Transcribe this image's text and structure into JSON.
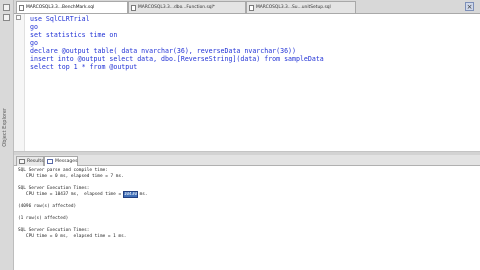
{
  "left_strip": {
    "label": "Object Explorer"
  },
  "tabs": [
    {
      "label": "MARCOSQL3.3...BenchMark.sql",
      "state": "active"
    },
    {
      "label": "MARCOSQL3.3...dbo...Function.sql*",
      "state": "inactive"
    },
    {
      "label": "MARCOSQL3.3...Su...unitSetup.sql",
      "state": "inactive"
    }
  ],
  "tab_close_glyph": "×",
  "editor": {
    "lines": [
      {
        "kw": "use",
        "rest": " SqlCLRTrial"
      },
      {
        "kw": "go",
        "rest": ""
      },
      {
        "kw": "set statistics time on",
        "rest": ""
      },
      {
        "kw": "go",
        "rest": ""
      },
      {
        "kw": "declare",
        "rest": " @output table( data nvarchar(36), reverseData nvarchar(36))"
      },
      {
        "kw": "insert into",
        "rest": " @output select data, dbo.[ReverseString](data) from sampleData"
      },
      {
        "kw": "select top",
        "rest": " 1 * from @output"
      }
    ]
  },
  "results_tabs": [
    {
      "label": "Results",
      "state": "inactive"
    },
    {
      "label": "Messages",
      "state": "active"
    }
  ],
  "messages": {
    "lines": [
      "SQL Server parse and compile time:",
      "   CPU time = 0 ms, elapsed time = 7 ms.",
      "",
      "SQL Server Execution Times:",
      "   CPU time = 10437 ms,  elapsed time = ",
      "",
      "(4096 row(s) affected)",
      "",
      "(1 row(s) affected)",
      "",
      "SQL Server Execution Times:",
      "   CPU time = 0 ms,  elapsed time = 1 ms."
    ],
    "highlight_value": "10430",
    "highlight_suffix": " ms."
  },
  "colors": {
    "keyword": "#2233d6",
    "highlight": "#3f6fb8"
  }
}
